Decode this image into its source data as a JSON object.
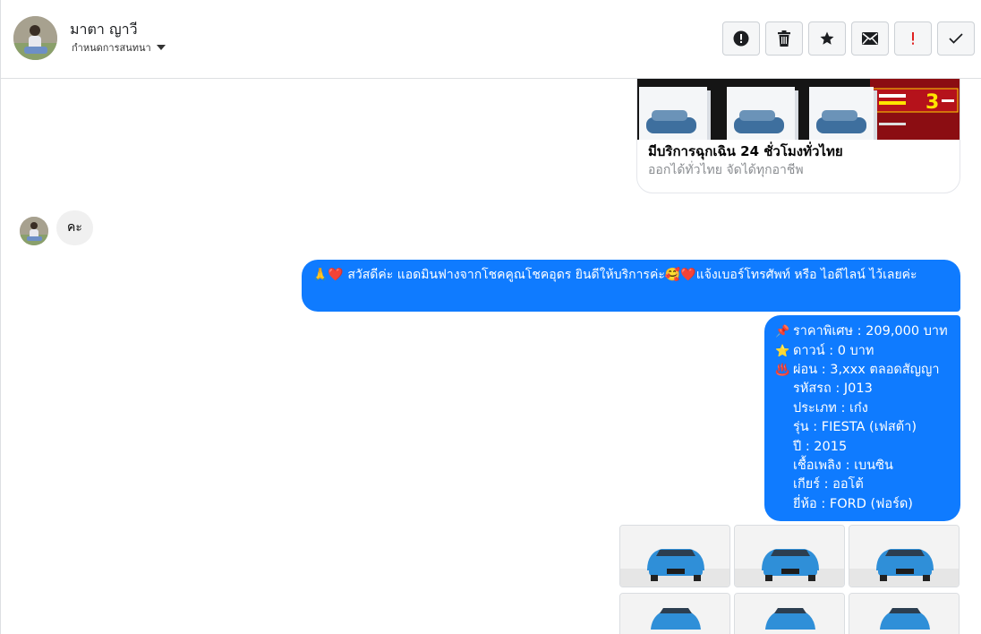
{
  "header": {
    "contact_name": "มาตา ญาวี",
    "assign_label": "กำหนดการสนทนา"
  },
  "actions": [
    {
      "icon": "alert-circle-icon",
      "name": "mark-spam-button"
    },
    {
      "icon": "trash-icon",
      "name": "delete-button"
    },
    {
      "icon": "star-icon",
      "name": "star-button"
    },
    {
      "icon": "envelope-icon",
      "name": "mark-unread-button"
    },
    {
      "icon": "exclamation-icon",
      "name": "follow-up-button"
    },
    {
      "icon": "check-icon",
      "name": "mark-done-button"
    }
  ],
  "card": {
    "title": "มีบริการฉุกเฉิน 24 ชั่วโมงทั่วไทย",
    "subtitle": "ออกได้ทั่วไทย จัดได้ทุกอาชีพ",
    "promo_text": "3"
  },
  "incoming": {
    "text": "คะ"
  },
  "outgoing_1": {
    "text": "🙏❤️ สวัสดีค่ะ แอดมินฟางจากโชคคูณโชคอุดร ยินดีให้บริการค่ะ🥰❤️แจ้งเบอร์โทรศัพท์ หรือ ไอดีไลน์  ไว้เลยค่ะ"
  },
  "outgoing_2": {
    "lines": [
      {
        "icon": "📌",
        "text": "ราคาพิเศษ : 209,000 บาท"
      },
      {
        "icon": "⭐",
        "text": "ดาวน์ : 0 บาท"
      },
      {
        "icon": "♨️",
        "text": "ผ่อน : 3,xxx ตลอดสัญญา"
      },
      {
        "icon": "",
        "text": "รหัสรถ : J013"
      },
      {
        "icon": "",
        "text": "ประเภท : เก๋ง"
      },
      {
        "icon": "",
        "text": "รุ่น : FIESTA (เฟสต้า)"
      },
      {
        "icon": "",
        "text": "ปี : 2015"
      },
      {
        "icon": "",
        "text": "เชื้อเพลิง : เบนซิน"
      },
      {
        "icon": "",
        "text": "เกียร์ : ออโต้"
      },
      {
        "icon": "",
        "text": "ยี่ห้อ : FORD (ฟอร์ด)"
      }
    ]
  },
  "colors": {
    "accent": "#0f7bff",
    "incoming_bubble": "#f0f0f0",
    "car_blue": "#2f8fd8"
  }
}
